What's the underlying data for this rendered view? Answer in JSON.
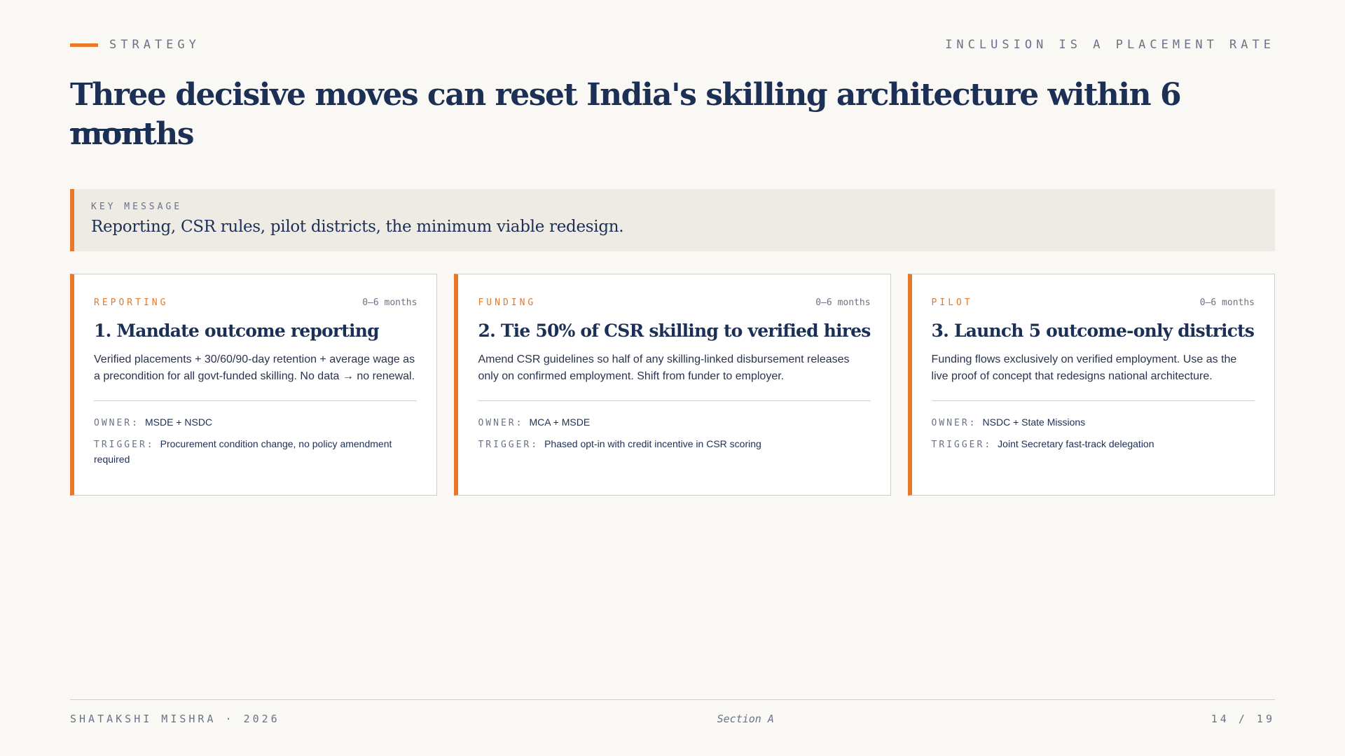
{
  "header": {
    "section": "STRATEGY",
    "tagline": "INCLUSION IS A PLACEMENT RATE"
  },
  "title": "Three decisive moves can reset India's skilling architecture within 6 months",
  "key_message": {
    "label": "KEY MESSAGE",
    "text": "Reporting, CSR rules, pilot districts, the minimum viable redesign."
  },
  "cards": [
    {
      "category": "REPORTING",
      "period": "0–6 months",
      "title": "1. Mandate outcome reporting",
      "body": "Verified placements + 30/60/90-day retention + average wage as a precondition for all govt-funded skilling. No data → no renewal.",
      "owner_label": "OWNER:",
      "owner": "MSDE + NSDC",
      "trigger_label": "TRIGGER:",
      "trigger": "Procurement condition change, no policy amendment required"
    },
    {
      "category": "FUNDING",
      "period": "0–6 months",
      "title": "2. Tie 50% of CSR skilling to verified hires",
      "body": "Amend CSR guidelines so half of any skilling-linked disbursement releases only on confirmed employment. Shift from funder to employer.",
      "owner_label": "OWNER:",
      "owner": "MCA + MSDE",
      "trigger_label": "TRIGGER:",
      "trigger": "Phased opt-in with credit incentive in CSR scoring"
    },
    {
      "category": "PILOT",
      "period": "0–6 months",
      "title": "3. Launch 5 outcome-only districts",
      "body": "Funding flows exclusively on verified employment. Use as the live proof of concept that redesigns national architecture.",
      "owner_label": "OWNER:",
      "owner": "NSDC + State Missions",
      "trigger_label": "TRIGGER:",
      "trigger": "Joint Secretary fast-track delegation"
    }
  ],
  "footer": {
    "author": "SHATAKSHI MISHRA · 2026",
    "section": "Section A",
    "page": "14 / 19"
  },
  "colors": {
    "accent": "#e8782a",
    "navy": "#1c2f55",
    "background": "#f9f8f5"
  }
}
